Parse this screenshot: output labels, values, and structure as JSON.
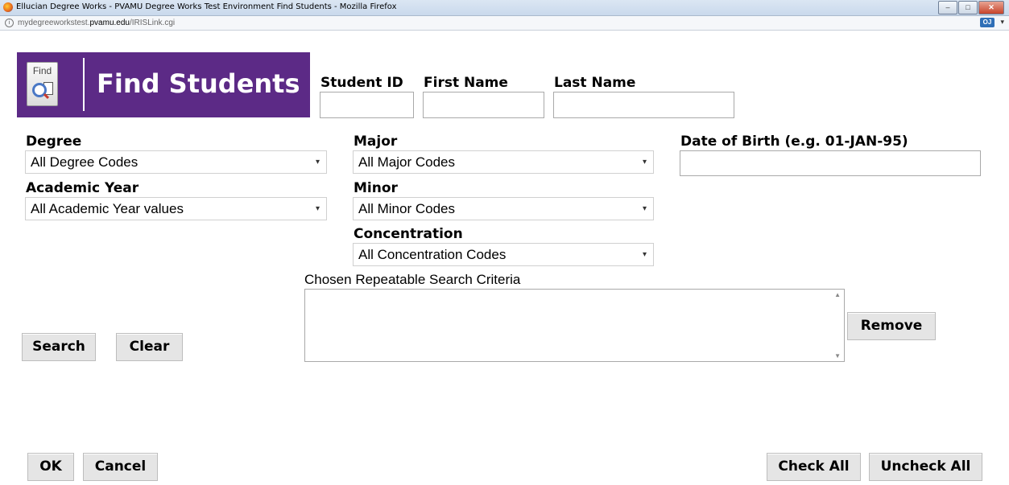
{
  "window": {
    "title": "Ellucian Degree Works - PVAMU Degree Works Test Environment Find Students - Mozilla Firefox",
    "url_prefix": "mydegreeworkstest.",
    "url_domain": "pvamu.edu",
    "url_suffix": "/IRISLink.cgi",
    "extension_label": "OJ"
  },
  "header": {
    "icon_text": "Find",
    "title": "Find Students"
  },
  "fields": {
    "student_id_label": "Student ID",
    "first_name_label": "First Name",
    "last_name_label": "Last Name",
    "degree_label": "Degree",
    "degree_value": "All Degree Codes",
    "academic_year_label": "Academic Year",
    "academic_year_value": "All Academic Year values",
    "major_label": "Major",
    "major_value": "All Major Codes",
    "minor_label": "Minor",
    "minor_value": "All Minor Codes",
    "concentration_label": "Concentration",
    "concentration_value": "All Concentration Codes",
    "dob_label": "Date of Birth (e.g. 01-JAN-95)"
  },
  "criteria": {
    "label": "Chosen Repeatable Search Criteria"
  },
  "buttons": {
    "search": "Search",
    "clear": "Clear",
    "remove": "Remove",
    "ok": "OK",
    "cancel": "Cancel",
    "check_all": "Check All",
    "uncheck_all": "Uncheck All"
  }
}
